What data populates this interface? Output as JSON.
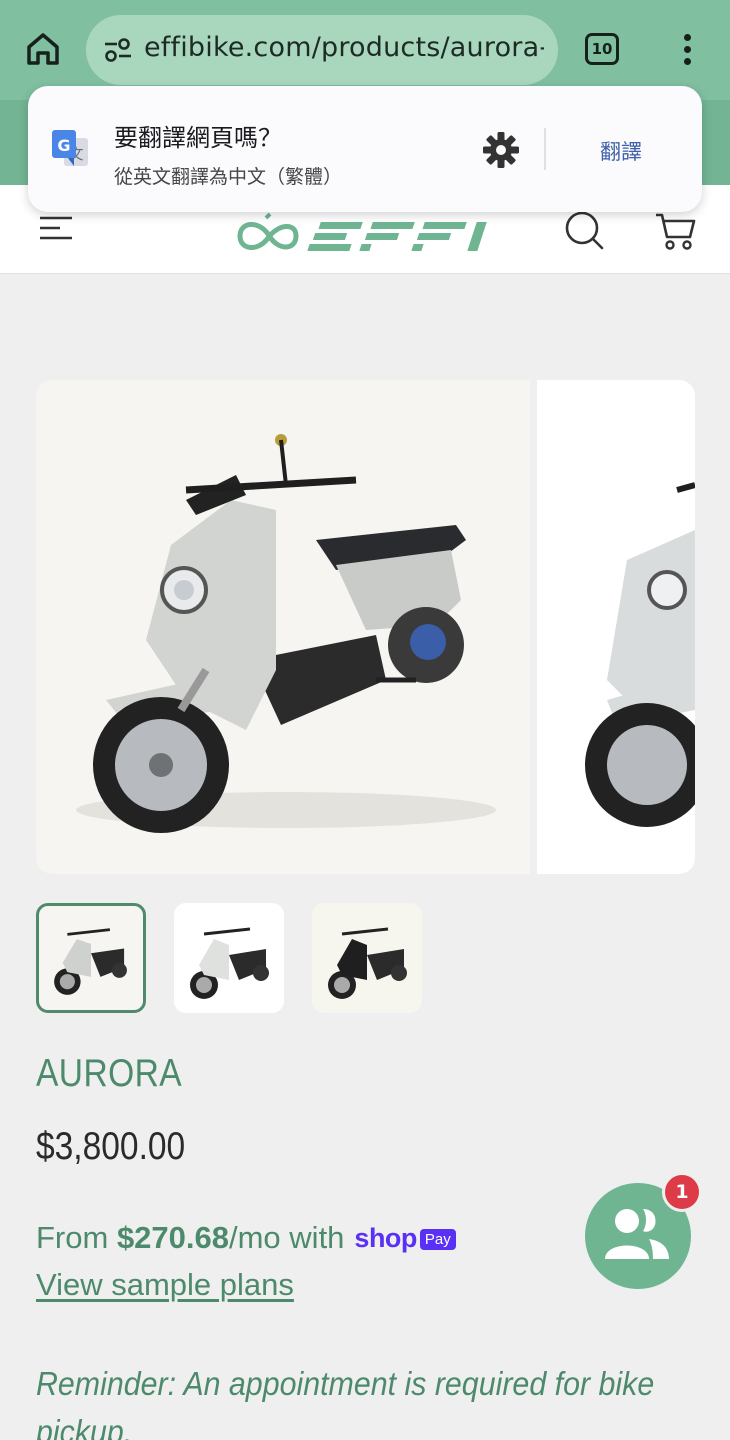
{
  "browser": {
    "url": "effibike.com/products/aurora-e",
    "tab_count": "10",
    "icons": [
      "home-icon",
      "site-settings-icon",
      "tab-switcher-icon",
      "more-vert-icon"
    ]
  },
  "translate_prompt": {
    "title": "要翻譯網頁嗎？",
    "subtitle": "從英文翻譯為中文（繁體）",
    "action": "翻譯",
    "icons": [
      "google-translate-icon",
      "gear-icon"
    ]
  },
  "header": {
    "brand": "EFFI",
    "icons": [
      "menu-icon",
      "search-icon",
      "cart-icon"
    ]
  },
  "gallery": {
    "thumbnail_count": 3,
    "selected_index": 0
  },
  "product": {
    "title": "AURORA",
    "price": "$3,800.00",
    "installment_prefix": "From ",
    "installment_amount": "$270.68",
    "installment_suffix": "/mo with",
    "shop_word": "shop",
    "pay_word": "Pay",
    "sample_plans_link": "View sample plans",
    "reminder": "Reminder: An appointment is required for bike pickup."
  },
  "chat": {
    "badge": "1",
    "icon": "people-icon"
  },
  "colors": {
    "brand_green": "#4d8a6c",
    "chrome_green": "#80bfa0",
    "shop_purple": "#5a31f4",
    "badge_red": "#dd3b48"
  }
}
